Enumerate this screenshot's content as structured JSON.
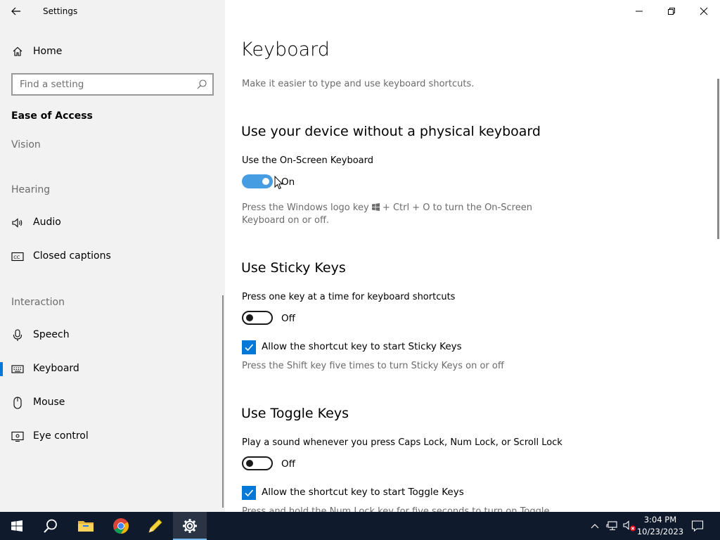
{
  "window": {
    "title": "Settings"
  },
  "sidebar": {
    "home_label": "Home",
    "search_placeholder": "Find a setting",
    "section_title": "Ease of Access",
    "groups": {
      "vision": "Vision",
      "hearing": "Hearing",
      "interaction": "Interaction"
    },
    "items": {
      "audio": "Audio",
      "closed_captions": "Closed captions",
      "speech": "Speech",
      "keyboard": "Keyboard",
      "mouse": "Mouse",
      "eye_control": "Eye control"
    },
    "selected_item": "Keyboard"
  },
  "main": {
    "title": "Keyboard",
    "description": "Make it easier to type and use keyboard shortcuts.",
    "osk": {
      "heading": "Use your device without a physical keyboard",
      "label": "Use the On-Screen Keyboard",
      "state": "On",
      "help_line1_a": "Press the Windows logo key",
      "help_line1_b": "+ Ctrl + O to turn the On-Screen",
      "help_line2": "Keyboard on or off."
    },
    "sticky": {
      "heading": "Use Sticky Keys",
      "label": "Press one key at a time for keyboard shortcuts",
      "state": "Off",
      "checkbox_label": "Allow the shortcut key to start Sticky Keys",
      "help": "Press the Shift key five times to turn Sticky Keys on or off"
    },
    "toggle_keys": {
      "heading": "Use Toggle Keys",
      "label": "Play a sound whenever you press Caps Lock, Num Lock, or Scroll Lock",
      "state": "Off",
      "checkbox_label": "Allow the shortcut key to start Toggle Keys",
      "help_partial": "Press and hold the Num Lock key for five seconds to turn on Toggle"
    }
  },
  "taskbar": {
    "time": "3:04 PM",
    "date": "10/23/2023",
    "apps": [
      "start-icon",
      "search-icon",
      "file-explorer-icon",
      "chrome-icon",
      "pencil-app-icon",
      "settings-icon"
    ]
  },
  "colors": {
    "accent": "#0078d7",
    "sidebar_bg": "#f2f2f2",
    "taskbar_bg": "#0f1a2c"
  }
}
